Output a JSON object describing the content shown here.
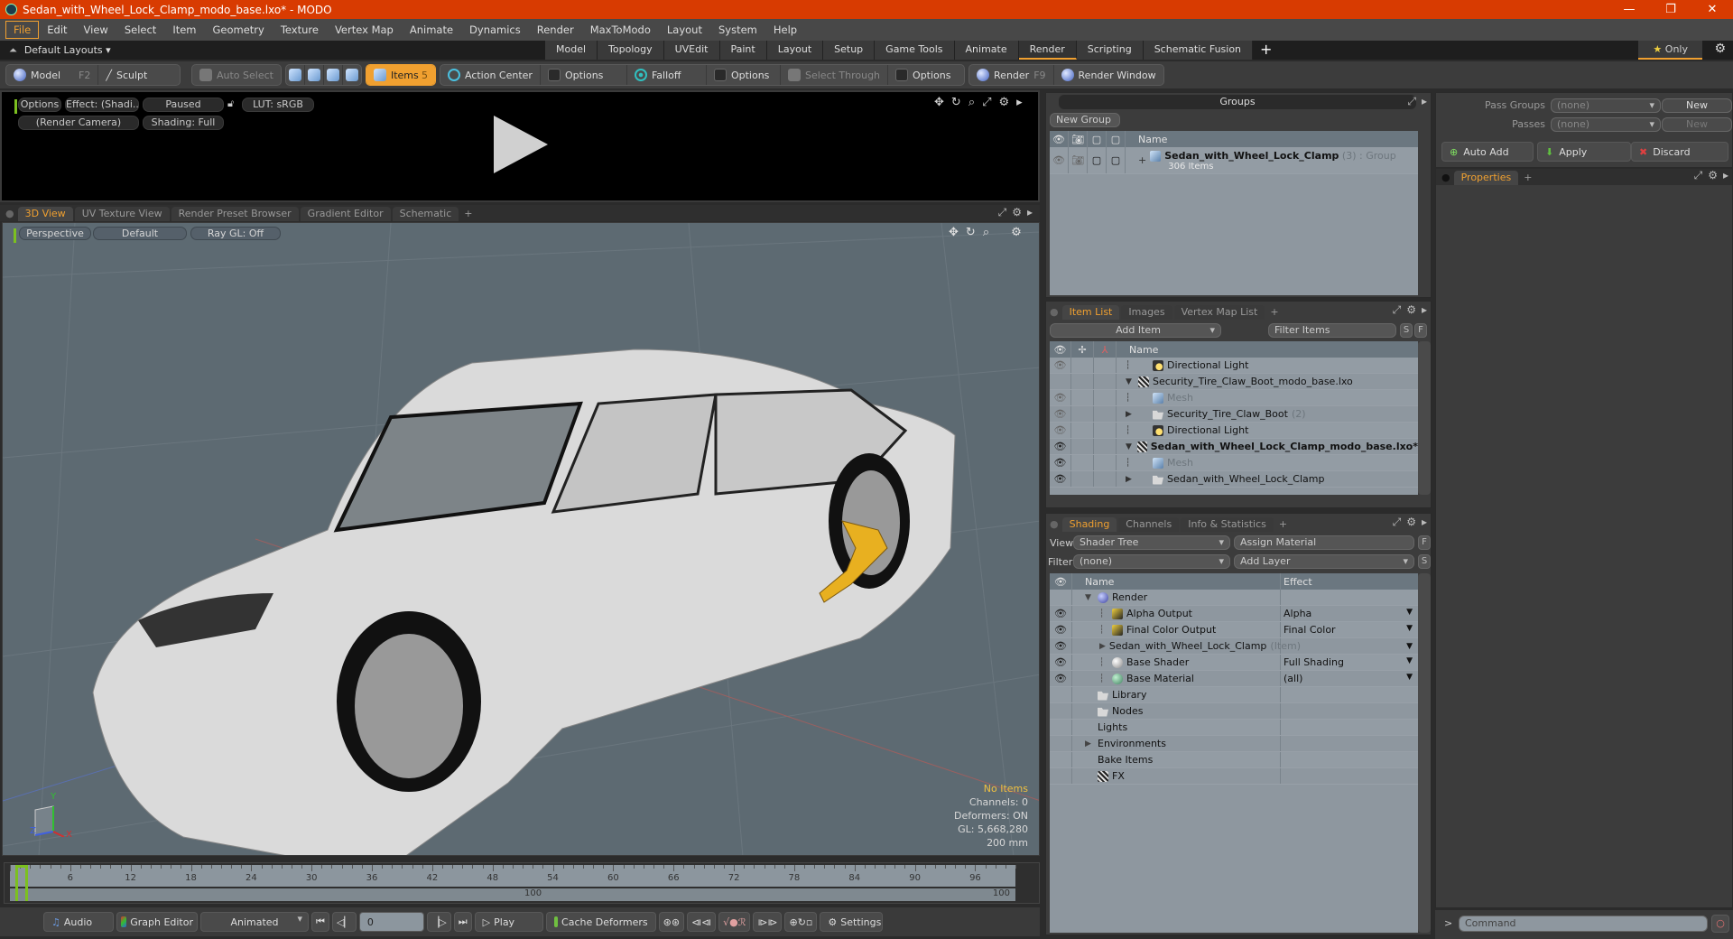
{
  "window": {
    "title": "Sedan_with_Wheel_Lock_Clamp_modo_base.lxo* - MODO",
    "minimize": "—",
    "maximize": "❐",
    "close": "✕"
  },
  "menu": [
    "File",
    "Edit",
    "View",
    "Select",
    "Item",
    "Geometry",
    "Texture",
    "Vertex Map",
    "Animate",
    "Dynamics",
    "Render",
    "MaxToModo",
    "Layout",
    "System",
    "Help"
  ],
  "layouts": {
    "default_label": "Default Layouts ▾",
    "tabs": [
      "Model",
      "Topology",
      "UVEdit",
      "Paint",
      "Layout",
      "Setup",
      "Game Tools",
      "Animate",
      "Render",
      "Scripting",
      "Schematic Fusion"
    ],
    "selected": "Render",
    "plus": "+",
    "only": "Only",
    "star": "★",
    "gear": "⚙"
  },
  "toolbar": {
    "model": "Model",
    "model_key": "F2",
    "sculpt": "Sculpt",
    "auto_select": "Auto Select",
    "items": "Items",
    "items_key": "5",
    "action_center": "Action Center",
    "options1": "Options",
    "falloff": "Falloff",
    "options2": "Options",
    "select_through": "Select Through",
    "options3": "Options",
    "render": "Render",
    "render_key": "F9",
    "render_window": "Render Window"
  },
  "render_preview": {
    "options": "Options",
    "effect": "Effect: (Shadi...",
    "paused": "Paused",
    "lut": "LUT: sRGB",
    "camera": "(Render Camera)",
    "shading": "Shading: Full"
  },
  "viewport_tabs": {
    "tabs": [
      "3D View",
      "UV Texture View",
      "Render Preset Browser",
      "Gradient Editor",
      "Schematic"
    ],
    "selected": "3D View",
    "plus": "+"
  },
  "viewport": {
    "perspective": "Perspective",
    "default": "Default",
    "raygl": "Ray GL: Off",
    "stats": {
      "items": "No Items",
      "channels": "Channels: 0",
      "deformers": "Deformers: ON",
      "gl": "GL: 5,668,280",
      "scale": "200 mm"
    },
    "axis": {
      "x": "X",
      "y": "Y",
      "z": "Z"
    }
  },
  "timeline": {
    "ticks": [
      "6",
      "12",
      "18",
      "24",
      "30",
      "36",
      "42",
      "48",
      "54",
      "60",
      "66",
      "72",
      "78",
      "84",
      "90",
      "96"
    ],
    "range_mid": "100",
    "range_end": "100",
    "current_frame": 0
  },
  "transport": {
    "audio": "Audio",
    "graph_editor": "Graph Editor",
    "animated": "Animated",
    "frame": "0",
    "play": "Play",
    "cache_deformers": "Cache Deformers",
    "settings": "Settings"
  },
  "groups": {
    "title": "Groups",
    "new_group": "New Group",
    "col_name": "Name",
    "rows": [
      {
        "name": "Sedan_with_Wheel_Lock_Clamp",
        "count": "(3)",
        "type": ": Group",
        "sub": "306 Items"
      }
    ]
  },
  "item_list": {
    "tabs": [
      "Item List",
      "Images",
      "Vertex Map List"
    ],
    "selected": "Item List",
    "plus": "+",
    "add_item": "Add Item",
    "filter_placeholder": "Filter Items",
    "s": "S",
    "f": "F",
    "col_name": "Name",
    "rows": [
      {
        "name": "Directional Light",
        "icon": "light",
        "indent": 2,
        "eye": "dim",
        "style": ""
      },
      {
        "name": "Security_Tire_Claw_Boot_modo_base.lxo",
        "icon": "clap",
        "indent": 1,
        "eye": "none",
        "style": "",
        "expander": "▼"
      },
      {
        "name": "Mesh",
        "icon": "mesh",
        "indent": 2,
        "eye": "dim",
        "style": "muted"
      },
      {
        "name": "Security_Tire_Claw_Boot",
        "count": "(2)",
        "icon": "folder",
        "indent": 2,
        "eye": "dim",
        "style": "",
        "expander": "▶"
      },
      {
        "name": "Directional Light",
        "icon": "light",
        "indent": 2,
        "eye": "dim",
        "style": ""
      },
      {
        "name": "Sedan_with_Wheel_Lock_Clamp_modo_base.lxo*",
        "icon": "clap",
        "indent": 1,
        "eye": "on",
        "style": "bold",
        "expander": "▼"
      },
      {
        "name": "Mesh",
        "icon": "mesh",
        "indent": 2,
        "eye": "on",
        "style": "muted"
      },
      {
        "name": "Sedan_with_Wheel_Lock_Clamp",
        "icon": "folder",
        "indent": 2,
        "eye": "on",
        "style": "",
        "expander": "▶"
      }
    ]
  },
  "shading": {
    "tabs": [
      "Shading",
      "Channels",
      "Info & Statistics"
    ],
    "selected": "Shading",
    "plus": "+",
    "view_label": "View",
    "view_value": "Shader Tree",
    "assign_material": "Assign Material",
    "f": "F",
    "filter_label": "Filter",
    "filter_value": "(none)",
    "add_layer": "Add Layer",
    "s": "S",
    "col_name": "Name",
    "col_effect": "Effect",
    "rows": [
      {
        "name": "Render",
        "effect": "",
        "icon": "render",
        "indent": 0,
        "eye": false,
        "expander": "▼"
      },
      {
        "name": "Alpha Output",
        "effect": "Alpha",
        "icon": "output",
        "indent": 1,
        "eye": true,
        "dd": true
      },
      {
        "name": "Final Color Output",
        "effect": "Final Color",
        "icon": "output",
        "indent": 1,
        "eye": true,
        "dd": true
      },
      {
        "name": "Sedan_with_Wheel_Lock_Clamp",
        "suffix": "(Item)",
        "effect": "",
        "icon": "mask",
        "indent": 1,
        "eye": true,
        "dd": true,
        "expander": "▶"
      },
      {
        "name": "Base Shader",
        "effect": "Full Shading",
        "icon": "shader",
        "indent": 1,
        "eye": true,
        "dd": true
      },
      {
        "name": "Base Material",
        "effect": "(all)",
        "icon": "material",
        "indent": 1,
        "eye": true,
        "dd": true
      },
      {
        "name": "Library",
        "effect": "",
        "icon": "folder",
        "indent": 0,
        "eye": false
      },
      {
        "name": "Nodes",
        "effect": "",
        "icon": "folder",
        "indent": 0,
        "eye": false
      },
      {
        "name": "Lights",
        "effect": "",
        "icon": "none",
        "indent": 0,
        "eye": false
      },
      {
        "name": "Environments",
        "effect": "",
        "icon": "none",
        "indent": 0,
        "eye": false,
        "expander": "▶"
      },
      {
        "name": "Bake Items",
        "effect": "",
        "icon": "none",
        "indent": 0,
        "eye": false
      },
      {
        "name": "FX",
        "effect": "",
        "icon": "clap",
        "indent": 0,
        "eye": false
      }
    ]
  },
  "passes": {
    "pass_groups_label": "Pass Groups",
    "pass_groups_value": "(none)",
    "new1": "New",
    "passes_label": "Passes",
    "passes_value": "(none)",
    "new2": "New",
    "auto_add": "Auto Add",
    "apply": "Apply",
    "discard": "Discard"
  },
  "properties": {
    "tab": "Properties",
    "plus": "+"
  },
  "command": {
    "prompt": ">",
    "placeholder": "Command"
  },
  "colors": {
    "accent": "#f0a030",
    "titlebar": "#d83b01",
    "viewport": "#5d6a72",
    "clamp": "#e8b020"
  }
}
